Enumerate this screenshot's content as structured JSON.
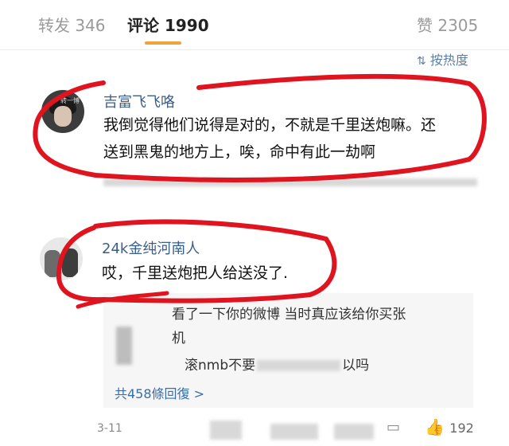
{
  "tabs": [
    {
      "label": "转发",
      "count": "346"
    },
    {
      "label": "评论",
      "count": "1990"
    },
    {
      "label": "赞",
      "count": "2305"
    }
  ],
  "sort": {
    "label": "按热度"
  },
  "comment1": {
    "username": "吉富飞飞咯",
    "avatar_tag": "转一博",
    "line1": "我倒觉得他们说得是对的，不就是千里送炮嘛。还",
    "line2": "送到黑鬼的地方上，唉，命中有此一劫啊"
  },
  "comment2": {
    "username": "24k金纯河南人",
    "text": "哎，千里送炮把人给送没了.",
    "reply": {
      "line1": "看了一下你的微博 当时真应该给你买张",
      "line2": "机",
      "line3_prefix": "滚nmb不要",
      "line3_suffix": "以吗"
    },
    "more_replies": "共458條回復 >",
    "date": "3-11",
    "likes": "192"
  },
  "colors": {
    "accent": "#f0a43a",
    "link": "#3a5e8c",
    "annotation": "#e0141e"
  }
}
